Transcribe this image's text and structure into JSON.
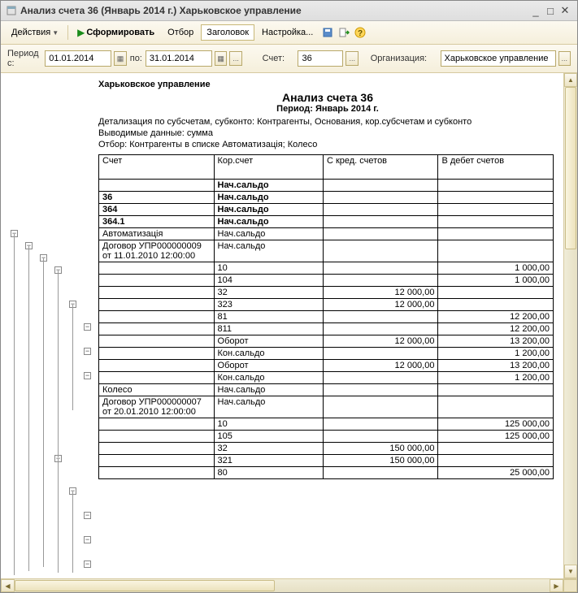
{
  "window": {
    "title": "Анализ счета 36 (Январь 2014 г.) Харьковское управление"
  },
  "toolbar": {
    "actions": "Действия",
    "form": "Сформировать",
    "filter": "Отбор",
    "header": "Заголовок",
    "settings": "Настройка..."
  },
  "params": {
    "period_from_label": "Период с:",
    "period_from": "01.01.2014",
    "period_to_label": "по:",
    "period_to": "31.01.2014",
    "account_label": "Счет:",
    "account": "36",
    "org_label": "Организация:",
    "org": "Харьковское управление"
  },
  "report": {
    "org": "Харьковское управление",
    "title": "Анализ счета 36",
    "period": "Период: Январь 2014 г.",
    "detail": "Детализация по  субсчетам, субконто: Контрагенты, Основания, кор.субсчетам и субконто",
    "output": "Выводимые данные: сумма",
    "filter": "Отбор: Контрагенты в списке Автоматизація; Колесо",
    "cols": {
      "c1": "Счет",
      "c2": "Кор.счет",
      "c3": "С кред. счетов",
      "c4": "В дебет счетов"
    },
    "rows": [
      {
        "a": "",
        "b": "Нач.сальдо",
        "c": "",
        "d": "",
        "bold": true
      },
      {
        "a": "36",
        "b": "Нач.сальдо",
        "c": "",
        "d": "",
        "bold": true
      },
      {
        "a": "364",
        "b": "Нач.сальдо",
        "c": "",
        "d": "",
        "bold": true
      },
      {
        "a": "364.1",
        "b": "Нач.сальдо",
        "c": "",
        "d": "",
        "bold": true
      },
      {
        "a": "Автоматизація",
        "b": "Нач.сальдо",
        "c": "",
        "d": ""
      },
      {
        "a": "Договор УПР000000009 от 11.01.2010 12:00:00",
        "b": "Нач.сальдо",
        "c": "",
        "d": ""
      },
      {
        "a": "",
        "b": "10",
        "c": "",
        "d": "1 000,00"
      },
      {
        "a": "",
        "b": "104",
        "c": "",
        "d": "1 000,00"
      },
      {
        "a": "",
        "b": "32",
        "c": "12 000,00",
        "d": ""
      },
      {
        "a": "",
        "b": "323",
        "c": "12 000,00",
        "d": ""
      },
      {
        "a": "",
        "b": "81",
        "c": "",
        "d": "12 200,00"
      },
      {
        "a": "",
        "b": "811",
        "c": "",
        "d": "12 200,00"
      },
      {
        "a": "",
        "b": "Оборот",
        "c": "12 000,00",
        "d": "13 200,00"
      },
      {
        "a": "",
        "b": "Кон.сальдо",
        "c": "",
        "d": "1 200,00"
      },
      {
        "a": "",
        "b": "Оборот",
        "c": "12 000,00",
        "d": "13 200,00"
      },
      {
        "a": "",
        "b": "Кон.сальдо",
        "c": "",
        "d": "1 200,00"
      },
      {
        "a": "Колесо",
        "b": "Нач.сальдо",
        "c": "",
        "d": ""
      },
      {
        "a": "Договор УПР000000007 от 20.01.2010 12:00:00",
        "b": "Нач.сальдо",
        "c": "",
        "d": ""
      },
      {
        "a": "",
        "b": "10",
        "c": "",
        "d": "125 000,00"
      },
      {
        "a": "",
        "b": "105",
        "c": "",
        "d": "125 000,00"
      },
      {
        "a": "",
        "b": "32",
        "c": "150 000,00",
        "d": ""
      },
      {
        "a": "",
        "b": "321",
        "c": "150 000,00",
        "d": ""
      },
      {
        "a": "",
        "b": "80",
        "c": "",
        "d": "25 000,00"
      }
    ]
  }
}
